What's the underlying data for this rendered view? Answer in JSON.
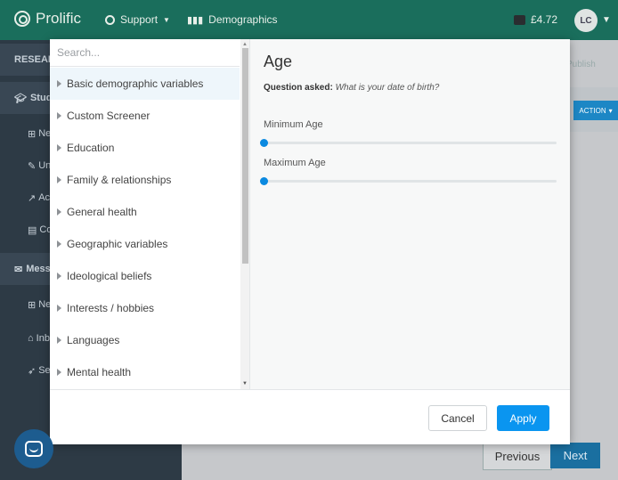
{
  "topbar": {
    "brand": "Prolific",
    "nav": [
      {
        "label": "Support",
        "icon": "lifebuoy-icon"
      },
      {
        "label": "Demographics",
        "icon": "bar-chart-icon"
      }
    ],
    "balance": "£4.72",
    "avatar_initials": "LC"
  },
  "sidebar": {
    "items": [
      {
        "label": "RESEARC"
      },
      {
        "label": "Studi"
      },
      {
        "label": "Ne"
      },
      {
        "label": "Un"
      },
      {
        "label": "Ac"
      },
      {
        "label": "Co"
      },
      {
        "label": "Mess"
      },
      {
        "label": "Ne"
      },
      {
        "label": "Inb"
      },
      {
        "label": "Se"
      }
    ]
  },
  "background": {
    "publish_label": "Publish",
    "action_label": "ACTION",
    "previous_label": "Previous",
    "next_label": "Next"
  },
  "modal": {
    "search_placeholder": "Search...",
    "categories": [
      "Basic demographic variables",
      "Custom Screener",
      "Education",
      "Family & relationships",
      "General health",
      "Geographic variables",
      "Ideological beliefs",
      "Interests / hobbies",
      "Languages",
      "Mental health"
    ],
    "active_category_index": 0,
    "detail": {
      "title": "Age",
      "question_label": "Question asked:",
      "question_text": "What is your date of birth?",
      "min_label": "Minimum Age",
      "max_label": "Maximum Age",
      "min_slider_fraction": 0,
      "max_slider_fraction": 0
    },
    "cancel_label": "Cancel",
    "apply_label": "Apply"
  },
  "colors": {
    "topbar": "#1a6e5c",
    "sidebar": "#2d3a45",
    "accent_blue": "#0a95f0",
    "slider_thumb": "#0a89e0"
  }
}
